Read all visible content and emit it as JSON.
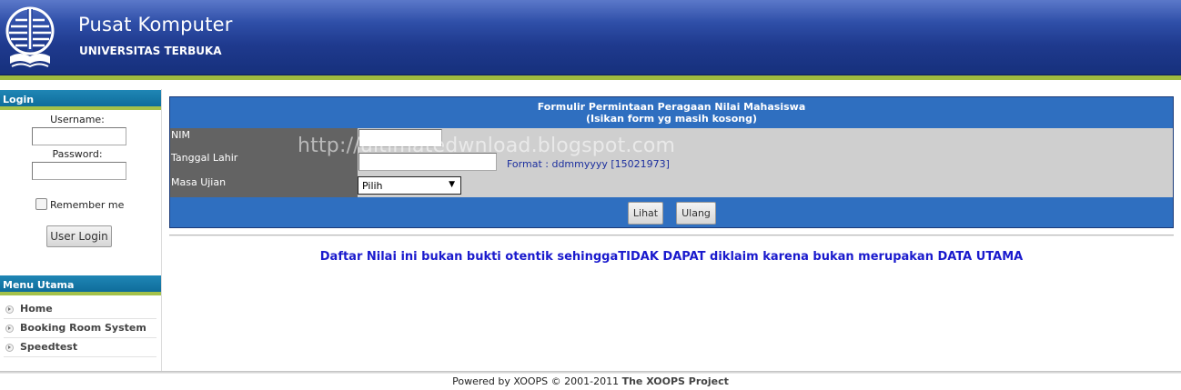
{
  "header": {
    "site_name": "Pusat Komputer",
    "slogan": "UNIVERSITAS TERBUKA",
    "logo_icon": "universitas-terbuka-logo"
  },
  "login": {
    "title": "Login",
    "username_label": "Username:",
    "username_value": "",
    "password_label": "Password:",
    "password_value": "",
    "remember_label": "Remember me",
    "remember_checked": false,
    "button_label": "User Login"
  },
  "menu": {
    "title": "Menu Utama",
    "items": [
      {
        "label": "Home",
        "icon": "chevron-right-icon"
      },
      {
        "label": "Booking Room System",
        "icon": "chevron-right-icon"
      },
      {
        "label": "Speedtest",
        "icon": "chevron-right-icon"
      }
    ]
  },
  "form": {
    "title_line1": "Formulir Permintaan Peragaan Nilai Mahasiswa",
    "title_line2": "(Isikan form yg masih kosong)",
    "nim_label": "NIM",
    "nim_value": "",
    "dob_label": "Tanggal Lahir",
    "dob_value": "",
    "dob_hint": "Format : ddmmyyyy [15021973]",
    "exam_label": "Masa Ujian",
    "exam_selected": "Pilih",
    "submit_label": "Lihat",
    "reset_label": "Ulang"
  },
  "watermark": "http://ultimatedwnload.blogspot.com",
  "notice": "Daftar Nilai ini bukan bukti otentik sehinggaTIDAK DAPAT diklaim karena bukan merupakan DATA UTAMA",
  "footer": {
    "prefix": "Powered by XOOPS © 2001-2011",
    "link": "The XOOPS Project"
  },
  "colors": {
    "header_blue": "#1f3a8e",
    "accent_green": "#9dba3f",
    "block_title_blue": "#0f6d9b",
    "form_blue": "#2f6fc0",
    "label_gray": "#636363",
    "value_gray": "#cfcfcf",
    "notice_blue": "#1a1acd"
  }
}
